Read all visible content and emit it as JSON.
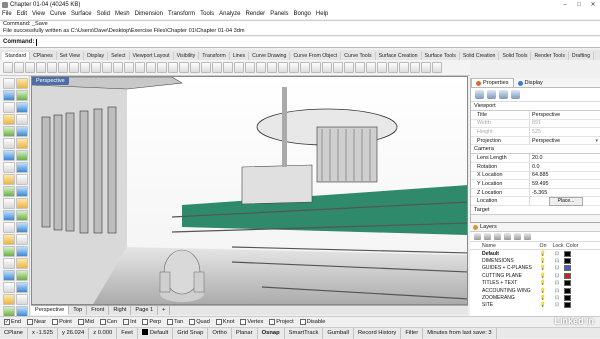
{
  "window": {
    "title": "Chapter 01-04 (40245 KB)"
  },
  "menu": [
    "File",
    "Edit",
    "View",
    "Curve",
    "Surface",
    "Solid",
    "Mesh",
    "Dimension",
    "Transform",
    "Tools",
    "Analyze",
    "Render",
    "Panels",
    "Bongo",
    "Help"
  ],
  "history": {
    "line1": "Command: _Save",
    "line2": "File successfully written as C:\\Users\\Dave\\Desktop\\Exercise Files\\Chapter 01\\Chapter 01-04 3dm"
  },
  "command": {
    "prompt": "Command:"
  },
  "toolbar_tabs": [
    "Standard",
    "CPlanes",
    "Set View",
    "Display",
    "Select",
    "Viewport Layout",
    "Visibility",
    "Transform",
    "Lines",
    "Curve Drawing",
    "Curve From Object",
    "Curve Tools",
    "Surface Creation",
    "Surface Tools",
    "Solid Creation",
    "Solid Tools",
    "Render Tools",
    "Drafting"
  ],
  "viewport": {
    "label": "Perspective"
  },
  "viewport_tabs": [
    "Perspective",
    "Top",
    "Front",
    "Right",
    "Page 1",
    "+"
  ],
  "osnap": [
    {
      "label": "End",
      "checked": true
    },
    {
      "label": "Near",
      "checked": false
    },
    {
      "label": "Point",
      "checked": false
    },
    {
      "label": "Mid",
      "checked": false
    },
    {
      "label": "Cen",
      "checked": false
    },
    {
      "label": "Int",
      "checked": false
    },
    {
      "label": "Perp",
      "checked": false
    },
    {
      "label": "Tan",
      "checked": false
    },
    {
      "label": "Quad",
      "checked": false
    },
    {
      "label": "Knot",
      "checked": false
    },
    {
      "label": "Vertex",
      "checked": false
    },
    {
      "label": "Project",
      "checked": false
    },
    {
      "label": "Disable",
      "checked": false
    }
  ],
  "status": {
    "cplane": "CPlane",
    "x": "x -1.525",
    "y": "y 26.024",
    "z": "z 0.000",
    "units": "Feet",
    "layer": "Default",
    "items": [
      "Grid Snap",
      "Ortho",
      "Planar",
      "Osnap",
      "SmartTrack",
      "Gumball",
      "Record History",
      "Filter",
      "Minutes from last save: 3"
    ]
  },
  "properties": {
    "tabs": [
      "Properties",
      "Display"
    ],
    "section_viewport": "Viewport",
    "rows": [
      {
        "k": "Title",
        "v": "Perspective",
        "disabled": false,
        "dd": false
      },
      {
        "k": "Width",
        "v": "891",
        "disabled": true,
        "dd": false
      },
      {
        "k": "Height",
        "v": "525",
        "disabled": true,
        "dd": false
      },
      {
        "k": "Projection",
        "v": "Perspective",
        "disabled": false,
        "dd": true
      }
    ],
    "section_camera": "Camera",
    "camera_rows": [
      {
        "k": "Lens Length",
        "v": "20.0"
      },
      {
        "k": "Rotation",
        "v": "0.0"
      },
      {
        "k": "X Location",
        "v": "64.885"
      },
      {
        "k": "Y Location",
        "v": "59.495"
      },
      {
        "k": "Z Location",
        "v": "-5.365"
      }
    ],
    "location_label": "Location",
    "place_button": "Place...",
    "section_target": "Target"
  },
  "layers": {
    "title": "Layers",
    "cols": {
      "name": "Name",
      "on": "On",
      "lock": "Lock",
      "color": "Color"
    },
    "rows": [
      {
        "name": "Default",
        "bold": true,
        "color": "#000000",
        "check": "✓"
      },
      {
        "name": "DIMENSIONS",
        "bold": false,
        "color": "#000000",
        "check": ""
      },
      {
        "name": "GUIDES + C-PLANES",
        "bold": false,
        "color": "#3b5fd0",
        "check": ""
      },
      {
        "name": "CUTTING PLANE",
        "bold": false,
        "color": "#d02020",
        "check": ""
      },
      {
        "name": "TITLES + TEXT",
        "bold": false,
        "color": "#000000",
        "check": ""
      },
      {
        "name": "ACCOUNTING WING",
        "bold": false,
        "color": "#000000",
        "check": ""
      },
      {
        "name": "ZOOMERANG",
        "bold": false,
        "color": "#000000",
        "check": ""
      },
      {
        "name": "SITE",
        "bold": false,
        "color": "#000000",
        "check": ""
      }
    ]
  },
  "watermark": "Linked in"
}
